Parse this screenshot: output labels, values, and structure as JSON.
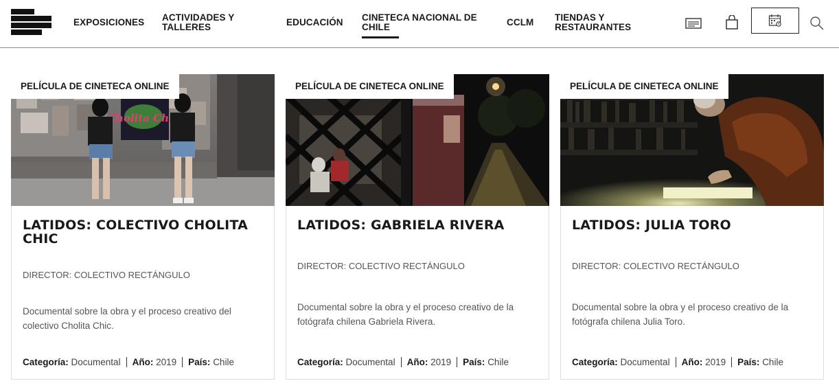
{
  "nav": {
    "items": [
      {
        "label": "EXPOSICIONES"
      },
      {
        "label": "ACTIVIDADES Y TALLERES"
      },
      {
        "label": "EDUCACIÓN"
      },
      {
        "label": "CINETECA NACIONAL DE CHILE"
      },
      {
        "label": "CCLM"
      },
      {
        "label": "TIENDAS Y RESTAURANTES"
      }
    ],
    "active_index": 3,
    "icons": [
      "ticket-icon",
      "shopping-bag-icon",
      "calendar-icon",
      "search-icon"
    ]
  },
  "cards": [
    {
      "tag": "PELÍCULA DE CINETECA ONLINE",
      "title": "LATIDOS: COLECTIVO CHOLITA CHIC",
      "director": "DIRECTOR: COLECTIVO RECTÁNGULO",
      "description": "Documental sobre la obra y el proceso creativo del colectivo Cholita Chic.",
      "category_label": "Categoría:",
      "category": "Documental",
      "year_label": "Año:",
      "year": "2019",
      "country_label": "País:",
      "country": "Chile",
      "image_mural_text": "Cholita Chic"
    },
    {
      "tag": "PELÍCULA DE CINETECA ONLINE",
      "title": "LATIDOS: GABRIELA RIVERA",
      "director": "DIRECTOR: COLECTIVO RECTÁNGULO",
      "description": "Documental sobre la obra y el proceso creativo de la fotógrafa chilena Gabriela Rivera.",
      "category_label": "Categoría:",
      "category": "Documental",
      "year_label": "Año:",
      "year": "2019",
      "country_label": "País:",
      "country": "Chile"
    },
    {
      "tag": "PELÍCULA DE CINETECA ONLINE",
      "title": "LATIDOS: JULIA TORO",
      "director": "DIRECTOR: COLECTIVO RECTÁNGULO",
      "description": "Documental sobre la obra y el proceso creativo de la fotógrafa chilena Julia Toro.",
      "category_label": "Categoría:",
      "category": "Documental",
      "year_label": "Año:",
      "year": "2019",
      "country_label": "País:",
      "country": "Chile"
    }
  ]
}
